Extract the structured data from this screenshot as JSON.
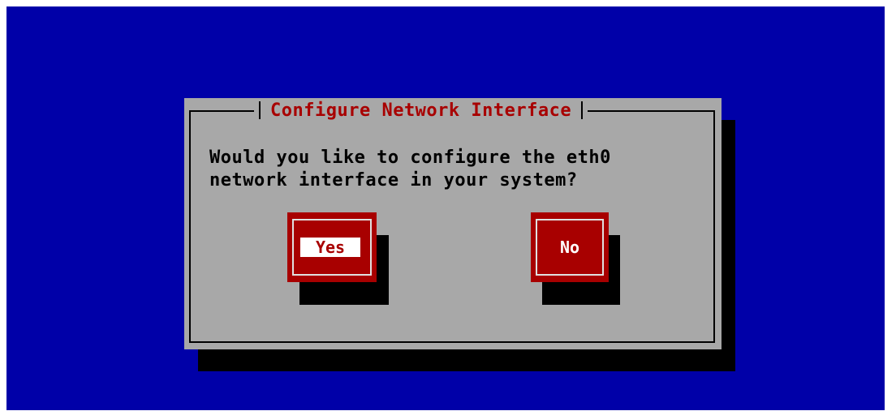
{
  "colors": {
    "background": "#0000a8",
    "dialog": "#a8a8a8",
    "shadow": "#000000",
    "title": "#a80000",
    "button": "#a80000",
    "button_text": "#ffffff"
  },
  "dialog": {
    "title": "Configure Network Interface",
    "message_line1": "Would you like to configure the eth0",
    "message_line2": "network interface in your system?",
    "buttons": {
      "yes": {
        "label": "Yes",
        "focused": true
      },
      "no": {
        "label": "No",
        "focused": false
      }
    }
  }
}
